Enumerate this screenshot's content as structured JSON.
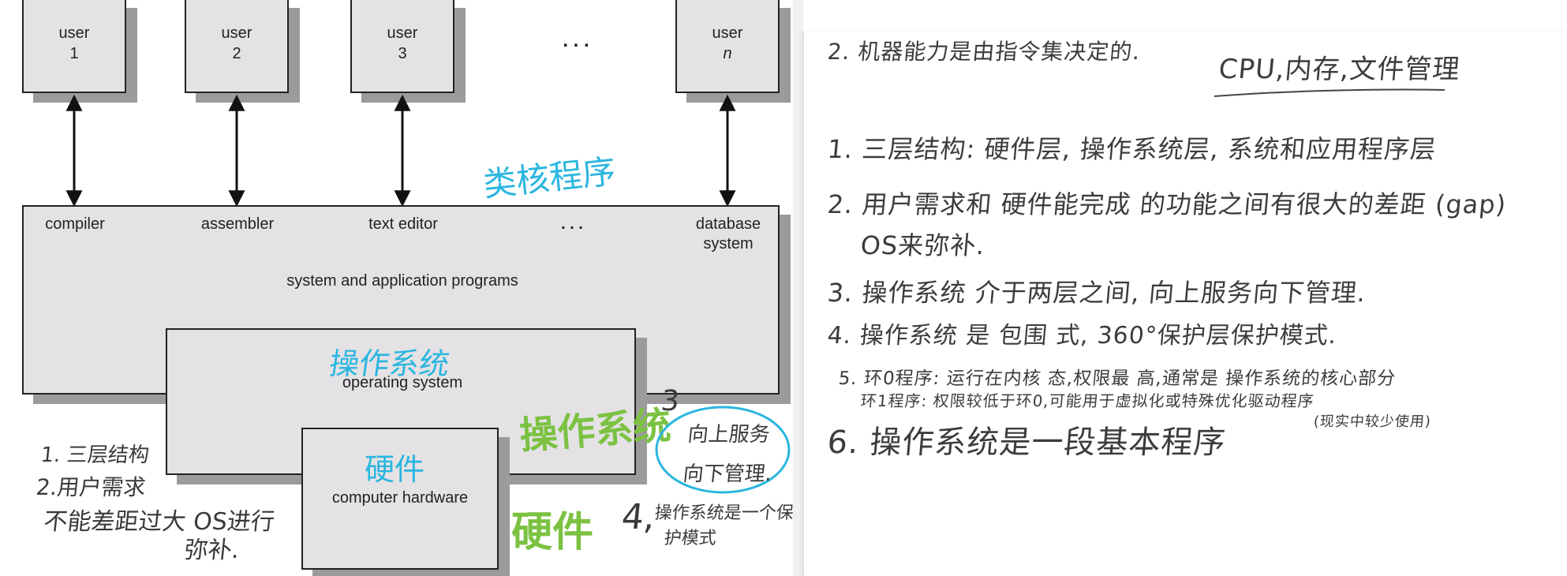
{
  "diagram": {
    "users": [
      {
        "line1": "user",
        "line2": "1"
      },
      {
        "line1": "user",
        "line2": "2"
      },
      {
        "line1": "user",
        "line2": "3"
      },
      {
        "line1": "user",
        "line2": "n"
      }
    ],
    "users_ellipsis": ". . .",
    "programs": [
      "compiler",
      "assembler",
      "text editor",
      ". . .",
      "database",
      "system"
    ],
    "programs_layer_label": "system and application programs",
    "os_label": "operating system",
    "hardware_label": "computer hardware",
    "colors": {
      "box_fill": "#e4e2e5",
      "shadow": "#9c9a9d",
      "blue_annotation": "#2ab6df",
      "green_annotation": "#7cc242"
    }
  },
  "annotations": {
    "cyan_top": "类核程序",
    "cyan_os": "操作系统",
    "cyan_hw": "硬件",
    "green_os": "操作系统",
    "green_hw": "硬件",
    "num3": "3",
    "num4": "4,",
    "circle_line1": "向上服务",
    "circle_line2": "向下管理.",
    "left_line1": "1. 三层结构",
    "left_line2": "2.用户需求",
    "left_line3": "不能差距过大 OS进行",
    "left_line4": "弥补.",
    "bottom_note": "操作系统是一个保",
    "bottom_note2": "护模式"
  },
  "notes": {
    "header_left": "2. 机器能力是由指令集决定的.",
    "header_right": "CPU,内存,文件管理",
    "items": [
      "1. 三层结构: 硬件层, 操作系统层, 系统和应用程序层",
      "2. 用户需求和 硬件能完成 的功能之间有很大的差距 (gap)",
      "OS来弥补.",
      "3. 操作系统 介于两层之间, 向上服务向下管理.",
      "4. 操作系统 是 包围 式, 360°保护层保护模式.",
      "5. 环0程序: 运行在内核 态,权限最 高,通常是 操作系统的核心部分",
      "环1程序: 权限较低于环0,可能用于虚拟化或特殊优化驱动程序",
      "(现实中较少使用)",
      "6. 操作系统是一段基本程序"
    ]
  }
}
